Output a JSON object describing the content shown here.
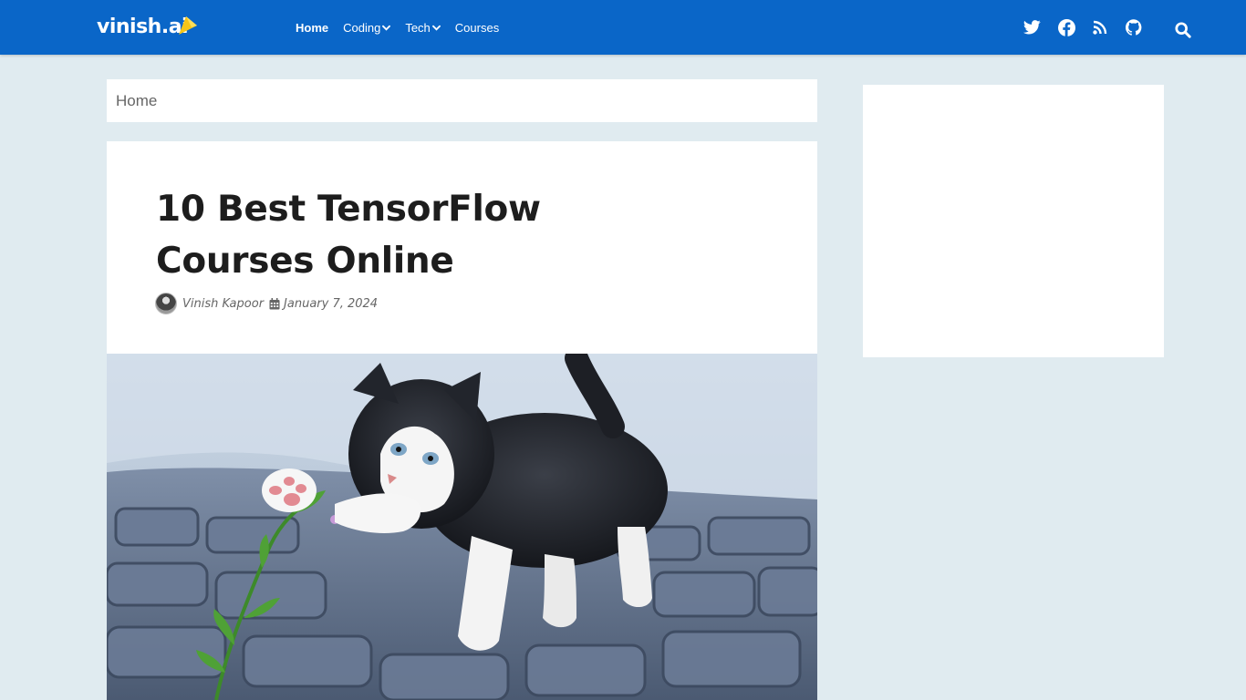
{
  "brand": {
    "name": "vinish.ai"
  },
  "nav": {
    "items": [
      {
        "label": "Home",
        "active": true,
        "has_dropdown": false
      },
      {
        "label": "Coding",
        "active": false,
        "has_dropdown": true
      },
      {
        "label": "Tech",
        "active": false,
        "has_dropdown": true
      },
      {
        "label": "Courses",
        "active": false,
        "has_dropdown": false
      }
    ],
    "icons": [
      "twitter-icon",
      "facebook-icon",
      "rss-icon",
      "github-icon",
      "search-icon"
    ]
  },
  "breadcrumb": {
    "label": "Home"
  },
  "article": {
    "title": "10 Best TensorFlow Courses Online",
    "author": "Vinish Kapoor",
    "date": "January 7, 2024"
  },
  "colors": {
    "navbar": "#0a66c8",
    "page_background": "#e0ebf0",
    "brand_accent": "#f5c518"
  }
}
